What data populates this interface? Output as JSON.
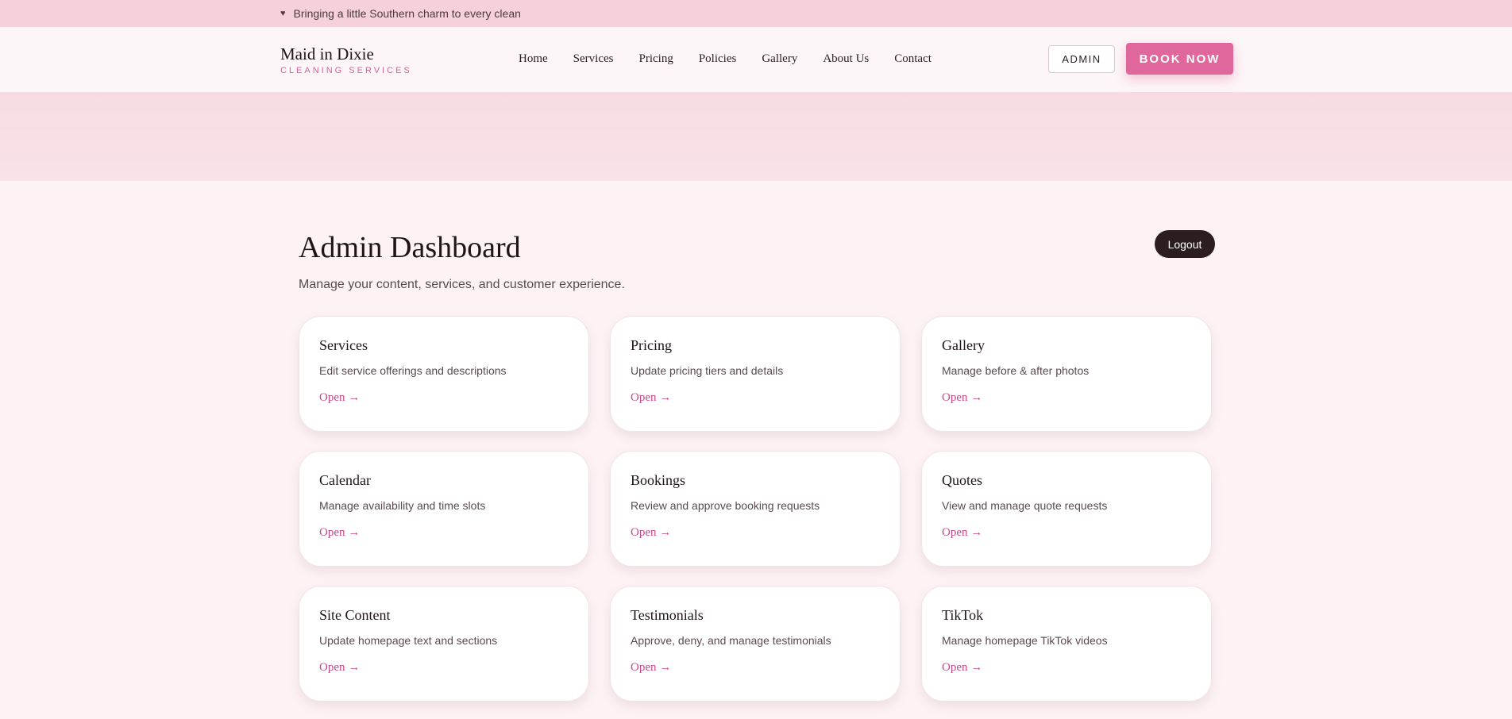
{
  "topbar": {
    "icon": "heart-icon",
    "text": "Bringing a little Southern charm to every clean"
  },
  "brand": {
    "name": "Maid in Dixie",
    "tagline": "CLEANING SERVICES"
  },
  "nav": [
    "Home",
    "Services",
    "Pricing",
    "Policies",
    "Gallery",
    "About Us",
    "Contact"
  ],
  "header": {
    "admin_label": "ADMIN",
    "book_label": "BOOK NOW"
  },
  "page": {
    "title": "Admin Dashboard",
    "subtitle": "Manage your content, services, and customer experience.",
    "logout_label": "Logout"
  },
  "cards": [
    {
      "title": "Services",
      "desc": "Edit service offerings and descriptions",
      "link": "Open →"
    },
    {
      "title": "Pricing",
      "desc": "Update pricing tiers and details",
      "link": "Open →"
    },
    {
      "title": "Gallery",
      "desc": "Manage before & after photos",
      "link": "Open →"
    },
    {
      "title": "Calendar",
      "desc": "Manage availability and time slots",
      "link": "Open →"
    },
    {
      "title": "Bookings",
      "desc": "Review and approve booking requests",
      "link": "Open →"
    },
    {
      "title": "Quotes",
      "desc": "View and manage quote requests",
      "link": "Open →"
    },
    {
      "title": "Site Content",
      "desc": "Update homepage text and sections",
      "link": "Open →"
    },
    {
      "title": "Testimonials",
      "desc": "Approve, deny, and manage testimonials",
      "link": "Open →"
    },
    {
      "title": "TikTok",
      "desc": "Manage homepage TikTok videos",
      "link": "Open →"
    }
  ],
  "colors": {
    "accent": "#e0679b",
    "link": "#c8478a",
    "topbar": "#f6d1da",
    "dark": "#2b1d20"
  }
}
